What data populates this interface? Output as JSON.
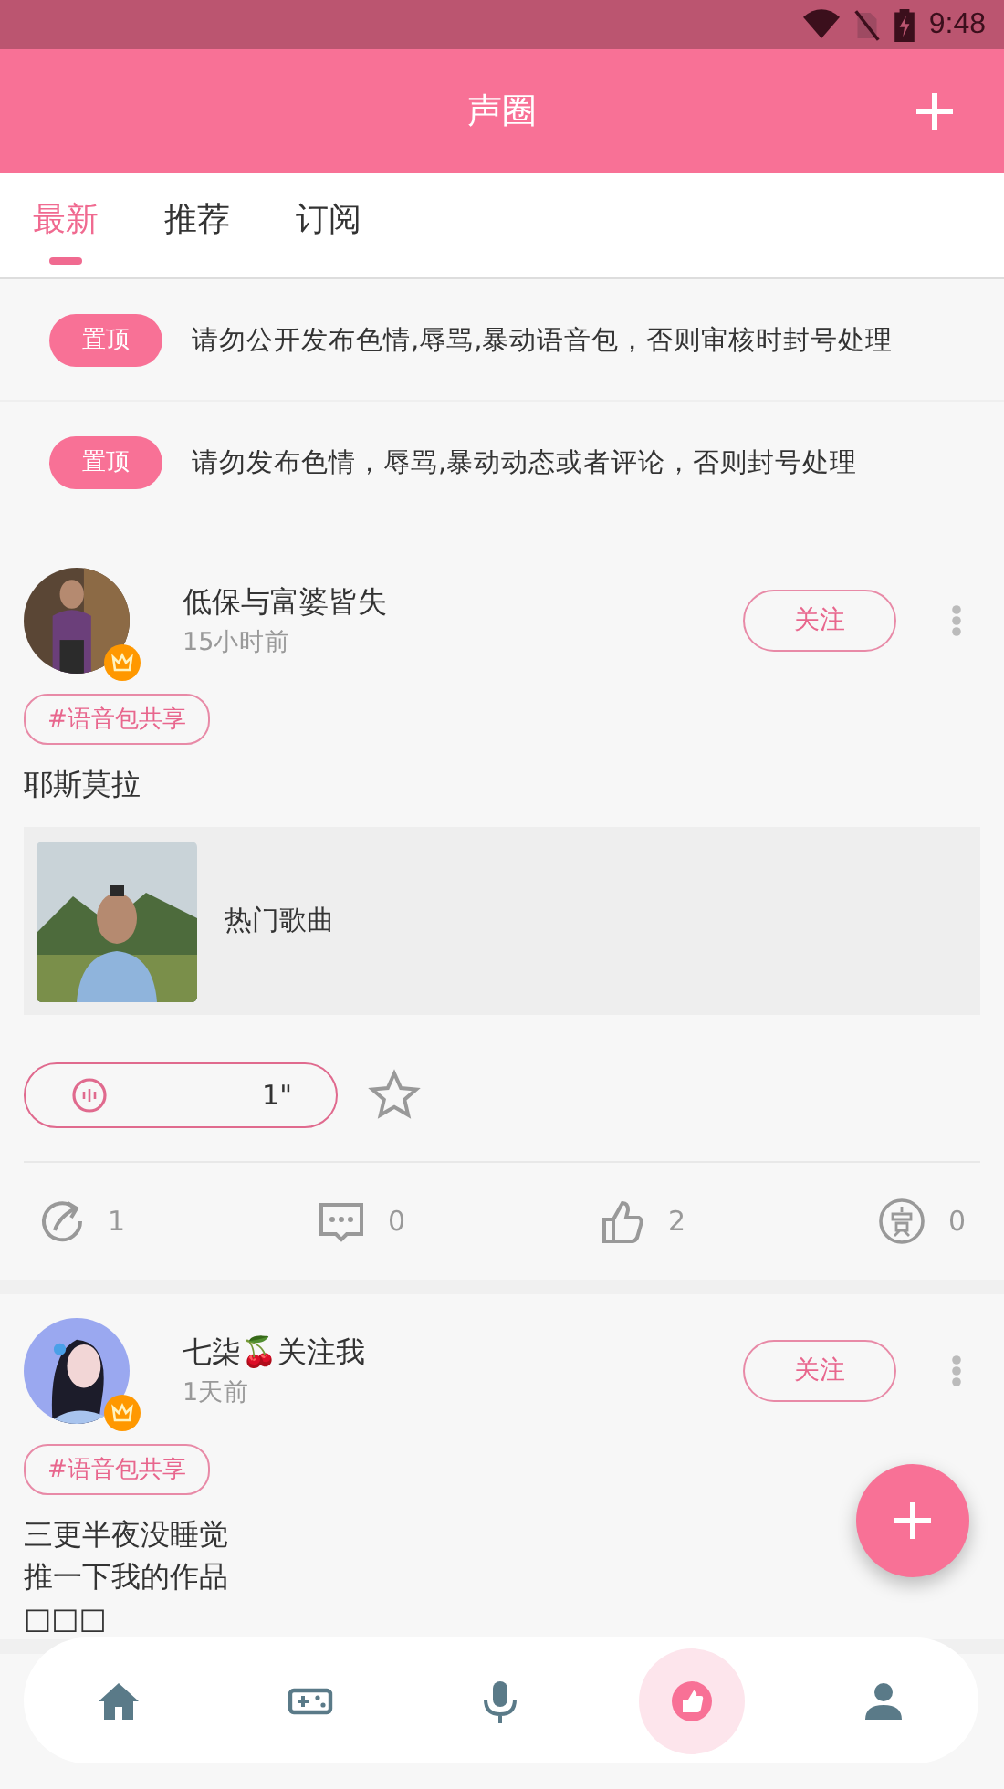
{
  "status_bar": {
    "time": "9:48"
  },
  "app_bar": {
    "title": "声圈"
  },
  "tabs": [
    {
      "label": "最新",
      "selected": true
    },
    {
      "label": "推荐",
      "selected": false
    },
    {
      "label": "订阅",
      "selected": false
    }
  ],
  "notices": [
    {
      "badge": "置顶",
      "text": "请勿公开发布色情,辱骂,暴动语音包，否则审核时封号处理"
    },
    {
      "badge": "置顶",
      "text": "请勿发布色情，辱骂,暴动动态或者评论，否则封号处理"
    }
  ],
  "posts": [
    {
      "username": "低保与富婆皆失",
      "time": "15小时前",
      "follow": "关注",
      "vip": true,
      "tag": "#语音包共享",
      "lines": [
        "耶斯莫拉"
      ],
      "song": {
        "title": "热门歌曲",
        "kind": "outdoor"
      },
      "voice": {
        "duration": "1\""
      },
      "starred": false,
      "stats": {
        "shares": "1",
        "comments": "0",
        "likes": "2",
        "rewards": "0"
      }
    },
    {
      "username": "七柒🍒关注我",
      "time": "1天前",
      "follow": "关注",
      "vip": true,
      "tag": "#语音包共享",
      "lines": [
        "三更半夜没睡觉",
        "推一下我的作品",
        "□□□"
      ]
    }
  ],
  "nav": [
    {
      "kind": "home",
      "selected": false
    },
    {
      "kind": "game",
      "selected": false
    },
    {
      "kind": "mic",
      "selected": false
    },
    {
      "kind": "circle",
      "selected": true
    },
    {
      "kind": "profile",
      "selected": false
    }
  ]
}
